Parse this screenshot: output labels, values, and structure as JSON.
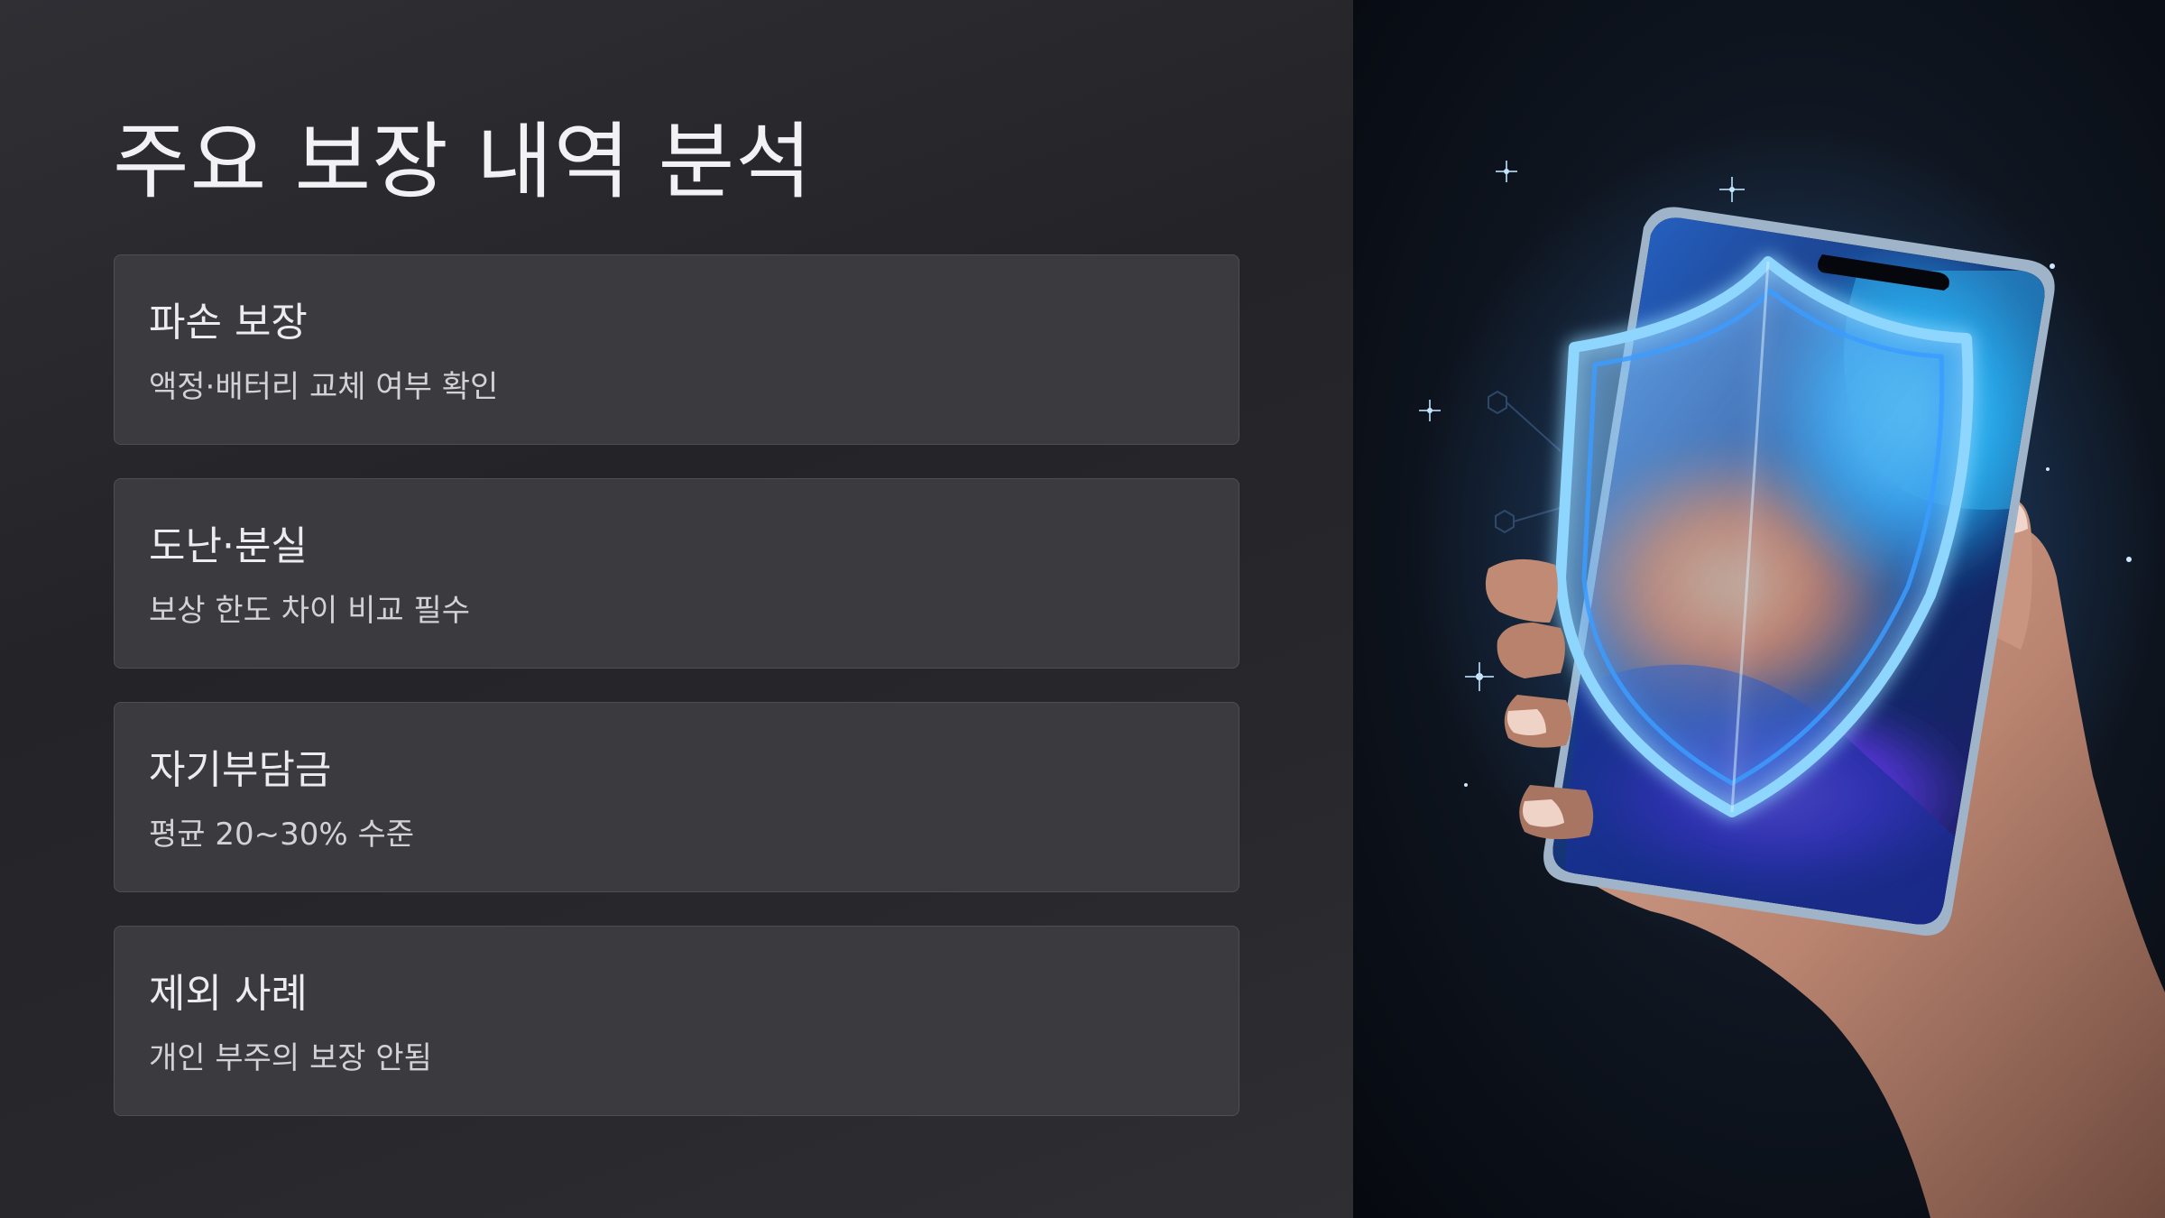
{
  "slide": {
    "title": "주요 보장 내역 분석",
    "cards": [
      {
        "title": "파손 보장",
        "description": "액정·배터리 교체 여부 확인"
      },
      {
        "title": "도난·분실",
        "description": "보상 한도 차이 비교 필수"
      },
      {
        "title": "자기부담금",
        "description": "평균 20~30% 수준"
      },
      {
        "title": "제외 사례",
        "description": "개인 부주의 보장 안됨"
      }
    ]
  },
  "illustration": {
    "subject": "hand-holding-smartphone-with-glowing-shield",
    "colors": {
      "background": "#0a0f18",
      "shield_glow": "#4fb0ff",
      "screen_orange": "#ff6a1a",
      "screen_blue": "#1e6be0",
      "screen_purple": "#6a3cf0"
    }
  }
}
